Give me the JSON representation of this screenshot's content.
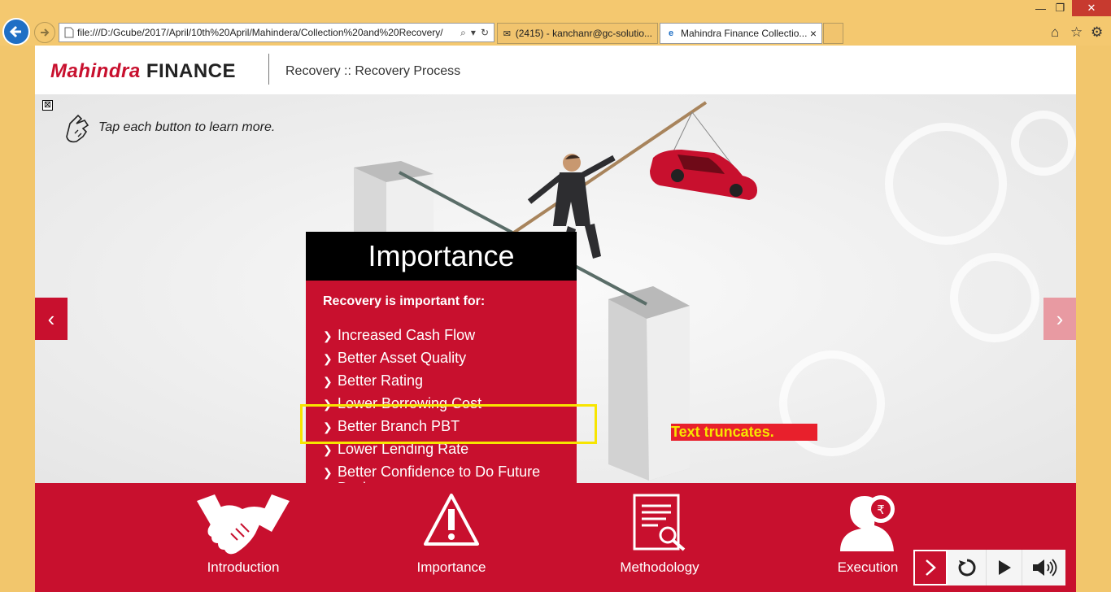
{
  "browser": {
    "address": "file:///D:/Gcube/2017/April/10th%20April/Mahindera/Collection%20and%20Recovery/",
    "tabs": [
      {
        "label": "(2415) - kanchanr@gc-solutio..."
      },
      {
        "label": "Mahindra Finance Collectio..."
      }
    ]
  },
  "header": {
    "logo_mahindra": "Mahindra",
    "logo_finance": "FINANCE",
    "title": "Recovery :: Recovery Process"
  },
  "stage": {
    "instruction": "Tap each button to learn more.",
    "close_symbol": "⊠",
    "prev_symbol": "‹",
    "next_symbol": "›"
  },
  "panel": {
    "title": "Importance",
    "intro": "Recovery is important for:",
    "items": [
      "Increased Cash Flow",
      "Better Asset Quality",
      "Better Rating",
      "Lower Borrowing Cost",
      "Better Branch PBT",
      "Lower Lending Rate",
      "Better Confidence to Do Future Business"
    ]
  },
  "annotation": {
    "text": "Text truncates."
  },
  "bottom_nav": [
    {
      "label": "Introduction",
      "icon": "handshake-icon"
    },
    {
      "label": "Importance",
      "icon": "warning-icon"
    },
    {
      "label": "Methodology",
      "icon": "document-search-icon"
    },
    {
      "label": "Execution",
      "icon": "rupee-gear-person-icon"
    }
  ],
  "colors": {
    "brand_red": "#c8102e",
    "highlight_yellow": "#f7e500",
    "pale_red": "#e89aa2"
  }
}
